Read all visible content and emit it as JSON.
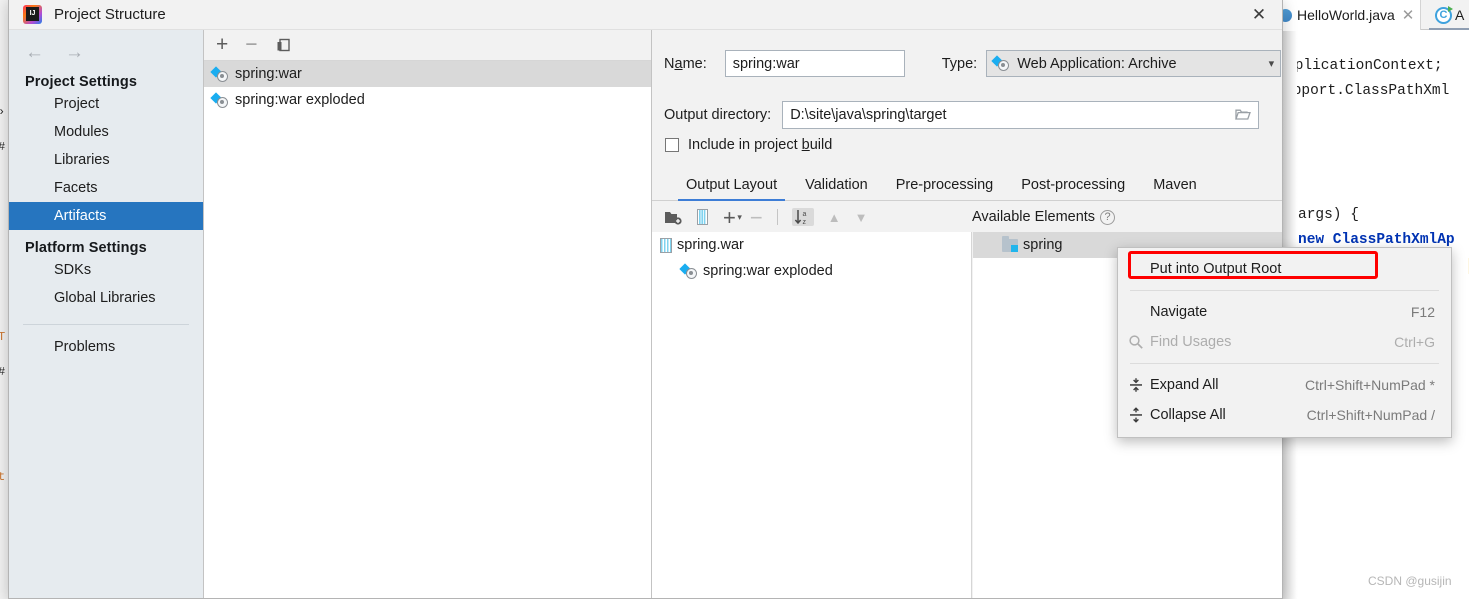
{
  "window": {
    "title": "Project Structure",
    "close_label": "✕",
    "logo_icon": "intellij-idea-logo"
  },
  "editor_background": {
    "tab_label": "HelloWorld.java",
    "tab_close": "✕",
    "next_tab_letter": "A",
    "code_lines": [
      "pplicationContext;",
      "upport.ClassPathXml",
      "args) {",
      "new ClassPathXmlAp",
      "(\""
    ],
    "watermark": "CSDN @gusijin"
  },
  "sidebar": {
    "back_arrow": "←",
    "forward_arrow": "→",
    "groups": [
      {
        "heading": "Project Settings",
        "items": [
          {
            "label": "Project",
            "selected": false
          },
          {
            "label": "Modules",
            "selected": false
          },
          {
            "label": "Libraries",
            "selected": false
          },
          {
            "label": "Facets",
            "selected": false
          },
          {
            "label": "Artifacts",
            "selected": true
          }
        ]
      },
      {
        "heading": "Platform Settings",
        "items": [
          {
            "label": "SDKs",
            "selected": false
          },
          {
            "label": "Global Libraries",
            "selected": false
          }
        ]
      }
    ],
    "footer_items": [
      {
        "label": "Problems",
        "selected": false
      }
    ]
  },
  "artifact_list": {
    "toolbar": [
      {
        "name": "add-artifact-button",
        "glyph": "+"
      },
      {
        "name": "remove-artifact-button",
        "glyph": "−"
      },
      {
        "name": "copy-artifact-button",
        "glyph": "copy-icon"
      }
    ],
    "items": [
      {
        "label": "spring:war",
        "selected": true
      },
      {
        "label": "spring:war exploded",
        "selected": false
      }
    ]
  },
  "detail": {
    "name_label": "Name:",
    "name_value": "spring:war",
    "type_label": "Type:",
    "type_value": "Web Application: Archive",
    "output_dir_label": "Output directory:",
    "output_dir_value": "D:\\site\\java\\spring\\target",
    "include_in_build_label": "Include in project build",
    "include_in_build_checked": false,
    "tabs": [
      {
        "label": "Output Layout",
        "active": true
      },
      {
        "label": "Validation",
        "active": false
      },
      {
        "label": "Pre-processing",
        "active": false
      },
      {
        "label": "Post-processing",
        "active": false
      },
      {
        "label": "Maven",
        "active": false
      }
    ],
    "layout_toolbar": [
      {
        "name": "add-directory-button",
        "glyph": "folder-add-icon"
      },
      {
        "name": "add-archive-button",
        "glyph": "archive-icon"
      },
      {
        "name": "add-element-button",
        "glyph": "+"
      },
      {
        "name": "remove-element-button",
        "glyph": "−"
      },
      {
        "name": "sort-alphabetically-button",
        "glyph": "sort-az-icon",
        "active": true
      },
      {
        "name": "move-up-button",
        "glyph": "▲"
      },
      {
        "name": "move-down-button",
        "glyph": "▼"
      }
    ],
    "available_elements_label": "Available Elements",
    "help_glyph": "?",
    "output_tree": [
      {
        "label": "spring.war",
        "icon": "war-archive-icon",
        "indent": 0
      },
      {
        "label": "spring:war exploded",
        "icon": "artifact-icon",
        "indent": 1
      }
    ],
    "available_tree": [
      {
        "label": "spring",
        "icon": "module-folder-icon",
        "selected": true
      }
    ]
  },
  "context_menu": {
    "items": [
      {
        "label": "Put into Output Root",
        "shortcut": "",
        "icon": "",
        "disabled": false,
        "highlighted": true
      },
      {
        "type": "separator"
      },
      {
        "label": "Navigate",
        "shortcut": "F12",
        "icon": "",
        "disabled": false,
        "highlighted": false
      },
      {
        "label": "Find Usages",
        "shortcut": "Ctrl+G",
        "icon": "search-icon",
        "disabled": true,
        "highlighted": false
      },
      {
        "type": "separator"
      },
      {
        "label": "Expand All",
        "shortcut": "Ctrl+Shift+NumPad *",
        "icon": "expand-all-icon",
        "disabled": false,
        "highlighted": false
      },
      {
        "label": "Collapse All",
        "shortcut": "Ctrl+Shift+NumPad /",
        "icon": "collapse-all-icon",
        "disabled": false,
        "highlighted": false
      }
    ],
    "highlight_color": "#ff0000"
  },
  "colors": {
    "selection_blue": "#2675bf",
    "tab_underline": "#3d7dd6",
    "nav_bg": "#e6ebef",
    "dialog_bg": "#f2f2f2"
  }
}
